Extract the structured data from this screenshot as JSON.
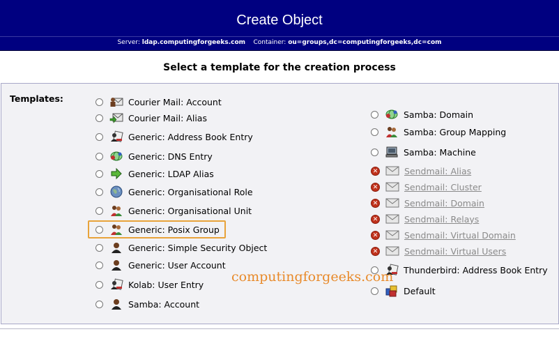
{
  "header": {
    "title": "Create Object",
    "server_label": "Server:",
    "server_value": "ldap.computingforgeeks.com",
    "container_label": "Container:",
    "container_value": "ou=groups,dc=computingforgeeks,dc=com"
  },
  "heading": "Select a template for the creation process",
  "templates_label": "Templates:",
  "left_templates": [
    {
      "label": "Courier Mail: Account",
      "icon": "mail-user-icon"
    },
    {
      "label": "Courier Mail: Alias",
      "icon": "mail-arrow-icon"
    },
    {
      "label": "Generic: Address Book Entry",
      "icon": "address-book-icon"
    },
    {
      "label": "Generic: DNS Entry",
      "icon": "dns-icon"
    },
    {
      "label": "Generic: LDAP Alias",
      "icon": "alias-arrow-icon"
    },
    {
      "label": "Generic: Organisational Role",
      "icon": "globe-icon"
    },
    {
      "label": "Generic: Organisational Unit",
      "icon": "group-icon"
    },
    {
      "label": "Generic: Posix Group",
      "icon": "group-icon"
    },
    {
      "label": "Generic: Simple Security Object",
      "icon": "user-icon"
    },
    {
      "label": "Generic: User Account",
      "icon": "user-icon"
    },
    {
      "label": "Kolab: User Entry",
      "icon": "address-book-icon"
    },
    {
      "label": "Samba: Account",
      "icon": "user-icon"
    }
  ],
  "right_templates": [
    {
      "label": "Samba: Domain",
      "icon": "dns-icon",
      "disabled": false
    },
    {
      "label": "Samba: Group Mapping",
      "icon": "group-icon",
      "disabled": false
    },
    {
      "label": "Samba: Machine",
      "icon": "computer-icon",
      "disabled": false
    },
    {
      "label": "Sendmail: Alias",
      "icon": "mail-icon",
      "disabled": true
    },
    {
      "label": "Sendmail: Cluster",
      "icon": "mail-icon",
      "disabled": true
    },
    {
      "label": "Sendmail: Domain",
      "icon": "mail-icon",
      "disabled": true
    },
    {
      "label": "Sendmail: Relays",
      "icon": "mail-icon",
      "disabled": true
    },
    {
      "label": "Sendmail: Virtual Domain",
      "icon": "mail-icon",
      "disabled": true
    },
    {
      "label": "Sendmail: Virtual Users",
      "icon": "mail-icon",
      "disabled": true
    },
    {
      "label": "Thunderbird: Address Book Entry",
      "icon": "address-book-icon",
      "disabled": false
    },
    {
      "label": "Default",
      "icon": "default-object-icon",
      "disabled": false
    }
  ],
  "watermark": "computingforgeeks.com",
  "colors": {
    "header_bg": "#000080",
    "highlight": "#e8a33a",
    "watermark": "#e88a2a",
    "disabled_x": "#c0321c"
  }
}
